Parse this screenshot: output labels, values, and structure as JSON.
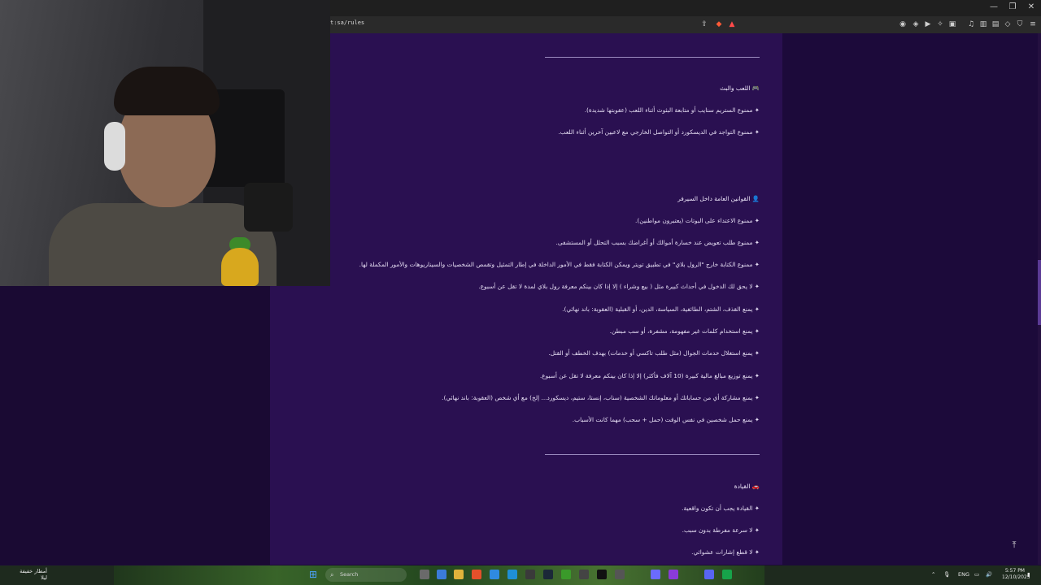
{
  "browser": {
    "url": "t:sa/rules",
    "window_controls": [
      "—",
      "❐",
      "✕"
    ]
  },
  "rules": {
    "section1_title": "🎮 اللعب والبث",
    "section1_items": [
      "✦ ممنوع الستريم سنايب أو متابعة البثوث أثناء اللعب (عقوبتها شديدة).",
      "✦ ممنوع التواجد في الديسكورد أو التواصل الخارجي مع لاعبين آخرين أثناء اللعب."
    ],
    "section2_title": "👤 القوانين العامة داخل السيرفر",
    "section2_items": [
      "✦ ممنوع الاعتداء على البوتات (يعتبرون مواطنين).",
      "✦ ممنوع طلب تعويض عند خسارة أموالك أو أغراضك بسبب التحلل أو المستشفى.",
      "✦ ممنوع الكتابة خارج \"الرول بلاي\" في تطبيق تويتر ويمكن الكتابة فقط في الأمور الداخلة في إطار التمثيل وتقمص الشخصيات والسيناريوهات والأمور المكملة لها.",
      "✦ لا يحق لك الدخول في أحداث كبيرة مثل ( بيع وشراء ) إلا إذا كان بينكم معرفة رول بلاي لمدة لا تقل عن أسبوع.",
      "✦ يمنع القذف، الشتم، الطائفية، السياسة، الدين، أو القبلية (العقوبة: باند نهائي).",
      "✦ يمنع استخدام كلمات غير مفهومة، مشفرة، أو سب مبطن.",
      "✦ يمنع استغلال خدمات الجوال (مثل طلب تاكسي أو خدمات) بهدف الخطف أو القتل.",
      "✦ يمنع توزيع مبالغ مالية كبيرة (10 آلاف فأكثر) إلا إذا كان بينكم معرفة لا تقل عن أسبوع.",
      "✦ يمنع مشاركة أي من حساباتك أو معلوماتك الشخصية (سناب، إنستا، ستيم، ديسكورد... إلخ) مع أي شخص (العقوبة: باند نهائي).",
      "✦ يمنع حمل شخصين في نفس الوقت (حمل + سحب) مهما كانت الأسباب."
    ],
    "section3_title": "🚗 القيادة",
    "section3_items": [
      "✦ القيادة يجب أن تكون واقعية.",
      "✦ لا سرعة مفرطة بدون سبب.",
      "✦ لا قطع إشارات عشوائي."
    ],
    "to_top": "⤒"
  },
  "taskbar": {
    "weather_line1": "أمطار خفيفة",
    "weather_line2": "ليلا",
    "search_placeholder": "Search",
    "language": "ENG",
    "time": "5:57 PM",
    "date": "12/10/2025"
  },
  "colors": {
    "page_bg": "#1a0a33",
    "content_bg": "#2a1051",
    "text": "#e4dcf2"
  }
}
